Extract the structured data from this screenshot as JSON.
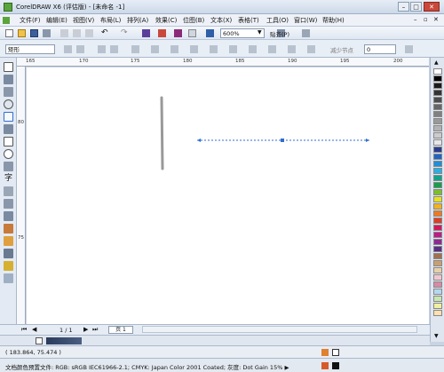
{
  "window": {
    "title": "CorelDRAW X6 (评估版) - [未命名 -1]"
  },
  "menu": [
    {
      "label": "文件(F)"
    },
    {
      "label": "编辑(E)"
    },
    {
      "label": "视图(V)"
    },
    {
      "label": "布局(L)"
    },
    {
      "label": "排列(A)"
    },
    {
      "label": "效果(C)"
    },
    {
      "label": "位图(B)"
    },
    {
      "label": "文本(X)"
    },
    {
      "label": "表格(T)"
    },
    {
      "label": "工具(O)"
    },
    {
      "label": "窗口(W)"
    },
    {
      "label": "帮助(H)"
    }
  ],
  "toolbar": {
    "zoom_value": "600%",
    "snap_label": "贴齐(P)"
  },
  "propbar": {
    "tool_select": "矩形",
    "reduce_nodes_label": "减少节点",
    "reduce_nodes_value": "0"
  },
  "ruler": {
    "h_ticks": [
      "165",
      "170",
      "175",
      "180",
      "185",
      "190",
      "195",
      "200"
    ],
    "v_ticks": [
      "80",
      "75"
    ]
  },
  "pages": {
    "counter": "1 / 1",
    "tab": "页 1"
  },
  "status": {
    "coords": "( 183.864, 75.474 )",
    "color_profile": "文档颜色预置文件: RGB: sRGB IEC61966-2.1; CMYK: Japan Color 2001 Coated; 灰度: Dot Gain 15% ▶"
  },
  "colors": {
    "accent": "#2f6fd0",
    "palette": [
      "#ffffff",
      "#000000",
      "#1a1a1a",
      "#333333",
      "#4d4d4d",
      "#666666",
      "#808080",
      "#999999",
      "#b3b3b3",
      "#cccccc",
      "#e6e6e6",
      "#2a3b8f",
      "#1f63c7",
      "#1e8fd8",
      "#27b0e6",
      "#0fa38a",
      "#12a14a",
      "#7bbf2a",
      "#e8e21a",
      "#f2b21c",
      "#ee7a1d",
      "#e23c23",
      "#d4175a",
      "#c2188a",
      "#8c2a91",
      "#5a2d87",
      "#a07050",
      "#c8a070",
      "#e8d0a8",
      "#f2c6d0",
      "#d88aa6",
      "#b4d8f0",
      "#c8e6b0",
      "#f0f0a0",
      "#ffe0b0"
    ]
  }
}
